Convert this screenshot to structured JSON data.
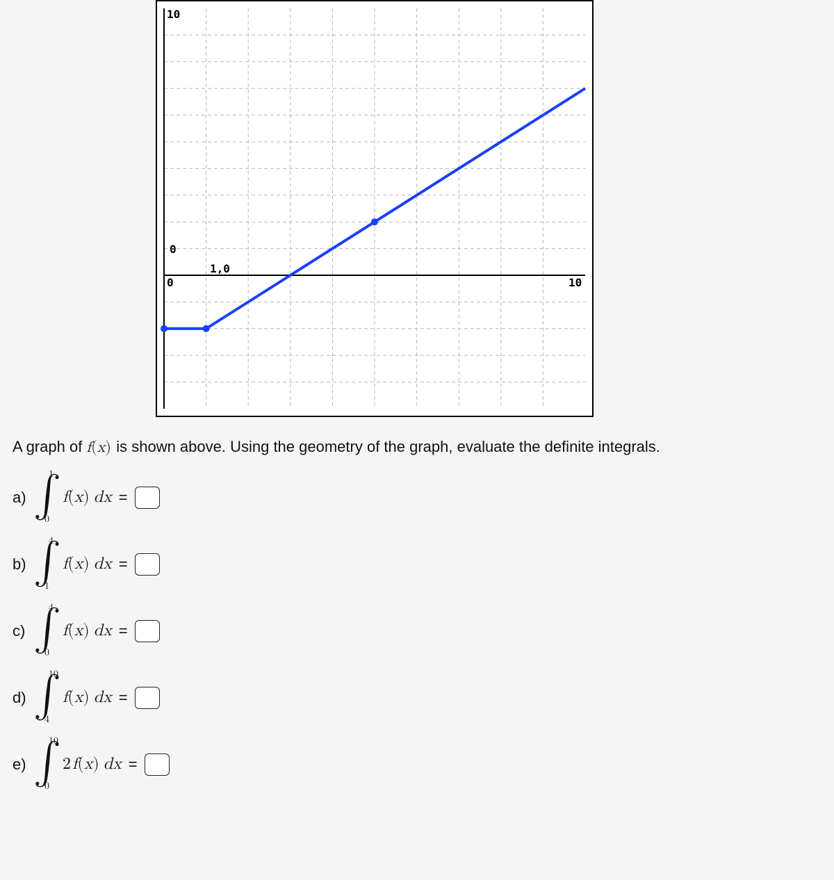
{
  "chart_data": {
    "type": "line",
    "title": "",
    "xlabel": "",
    "ylabel": "",
    "xlim": [
      0,
      10
    ],
    "ylim": [
      -5,
      10
    ],
    "x_ticks": [
      0,
      1,
      10
    ],
    "y_ticks": [
      0,
      10
    ],
    "series": [
      {
        "name": "f(x)",
        "x": [
          0,
          1,
          4,
          10
        ],
        "y": [
          -2,
          -2,
          1,
          7
        ]
      }
    ],
    "annotations": [
      {
        "text": "1,0",
        "x": 1,
        "y": 0
      }
    ],
    "grid": true
  },
  "instructions": {
    "prefix": "A graph of ",
    "fx": "f(x)",
    "suffix": " is shown above. Using the geometry of the graph, evaluate the definite integrals."
  },
  "problems": [
    {
      "letter": "a)",
      "lower": "0",
      "upper": "1",
      "coef": "",
      "func": "f(x)",
      "diff": "dx",
      "eq": "="
    },
    {
      "letter": "b)",
      "lower": "1",
      "upper": "4",
      "coef": "",
      "func": "f(x)",
      "diff": "dx",
      "eq": "="
    },
    {
      "letter": "c)",
      "lower": "0",
      "upper": "4",
      "coef": "",
      "func": "f(x)",
      "diff": "dx",
      "eq": "="
    },
    {
      "letter": "d)",
      "lower": "4",
      "upper": "10",
      "coef": "",
      "func": "f(x)",
      "diff": "dx",
      "eq": "="
    },
    {
      "letter": "e)",
      "lower": "0",
      "upper": "10",
      "coef": "2",
      "func": "f(x)",
      "diff": "dx",
      "eq": "="
    }
  ],
  "graph_labels": {
    "y_top": "10",
    "y_zero": "0",
    "x_zero": "0",
    "x_right": "10",
    "anno": "1,0"
  }
}
